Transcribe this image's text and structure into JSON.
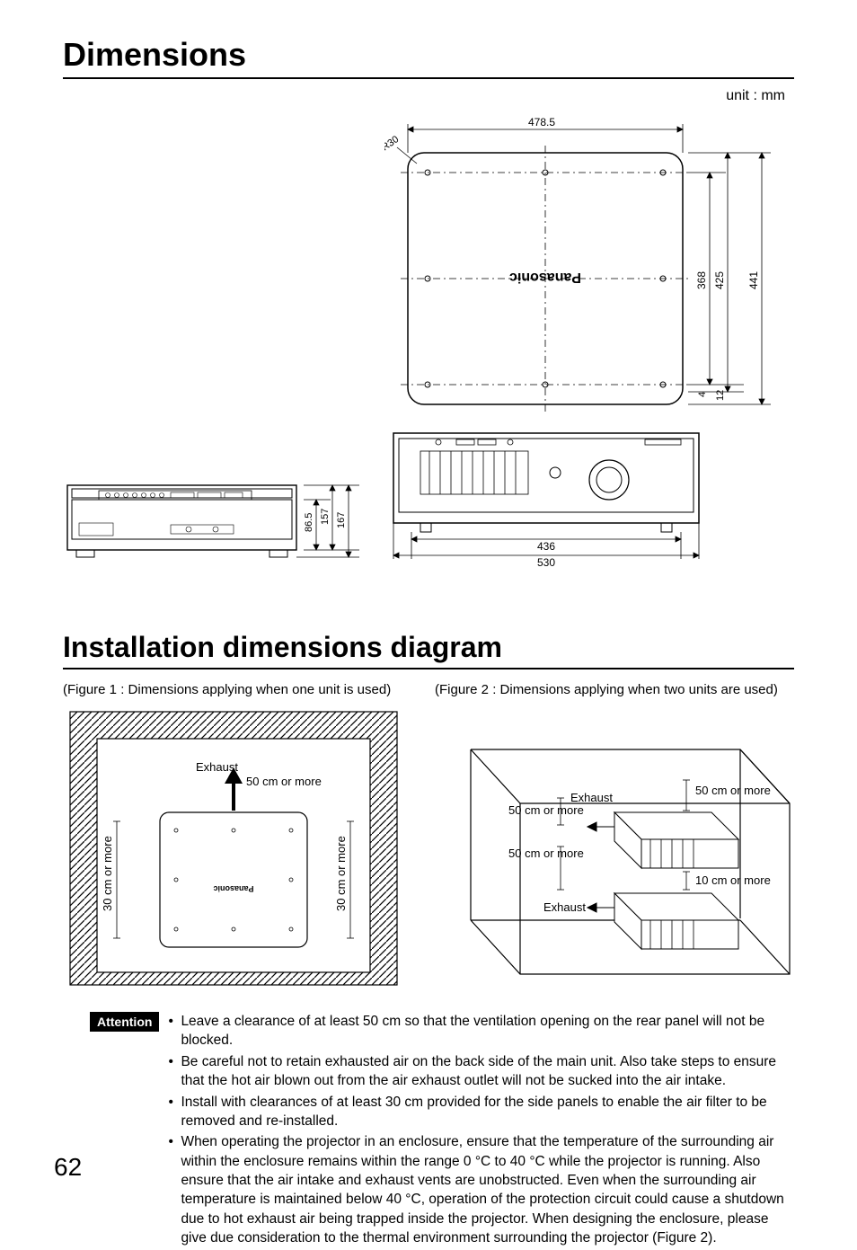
{
  "headings": {
    "h1": "Dimensions",
    "h2": "Installation dimensions diagram"
  },
  "unit_label": "unit : mm",
  "top_diagram": {
    "brand": "Panasonic",
    "dims": {
      "top_width": "478.5",
      "corner_radius": "R30",
      "height_outer": "441",
      "height_inner": "425",
      "height_screw": "368",
      "bottom_gap_outer": "12",
      "bottom_gap_inner": "4",
      "front_width_outer": "530",
      "front_width_inner": "436"
    }
  },
  "side_diagram": {
    "dims": {
      "h_outer": "167",
      "h_mid": "157",
      "h_inner": "86.5"
    }
  },
  "figures": {
    "fig1": {
      "caption": "(Figure 1 : Dimensions applying when one unit is used)",
      "labels": {
        "exhaust": "Exhaust",
        "top_clear": "50 cm or more",
        "side_clear_l": "30 cm or more",
        "side_clear_r": "30 cm or more"
      }
    },
    "fig2": {
      "caption": "(Figure 2 : Dimensions applying when two units are used)",
      "labels": {
        "exhaust1": "Exhaust",
        "exhaust2": "Exhaust",
        "clear_50a": "50 cm or more",
        "clear_50b": "50 cm or more",
        "clear_50c": "50 cm or more",
        "clear_10": "10 cm or more"
      }
    }
  },
  "attention": {
    "badge": "Attention",
    "items": [
      "Leave a clearance of at least 50 cm so that the ventilation opening on the rear panel will not be blocked.",
      "Be careful not to retain exhausted air on the back side of the main unit. Also take steps to ensure that the hot air blown out from the air exhaust outlet will not be sucked into the air intake.",
      "Install with clearances of at least 30 cm provided for the side panels to enable the air filter to be removed and re-installed.",
      "When operating the projector in an enclosure, ensure that the temperature of the surrounding air within the enclosure remains within the range 0 °C to 40 °C while the projector is running. Also ensure that the air intake and exhaust vents are unobstructed. Even when the surrounding air temperature is maintained below 40 °C, operation of the protection circuit could cause a shutdown due to hot exhaust air being trapped inside the projector. When designing the enclosure, please give due consideration to the thermal environment surrounding the projector (Figure 2)."
    ]
  },
  "page_number": "62"
}
